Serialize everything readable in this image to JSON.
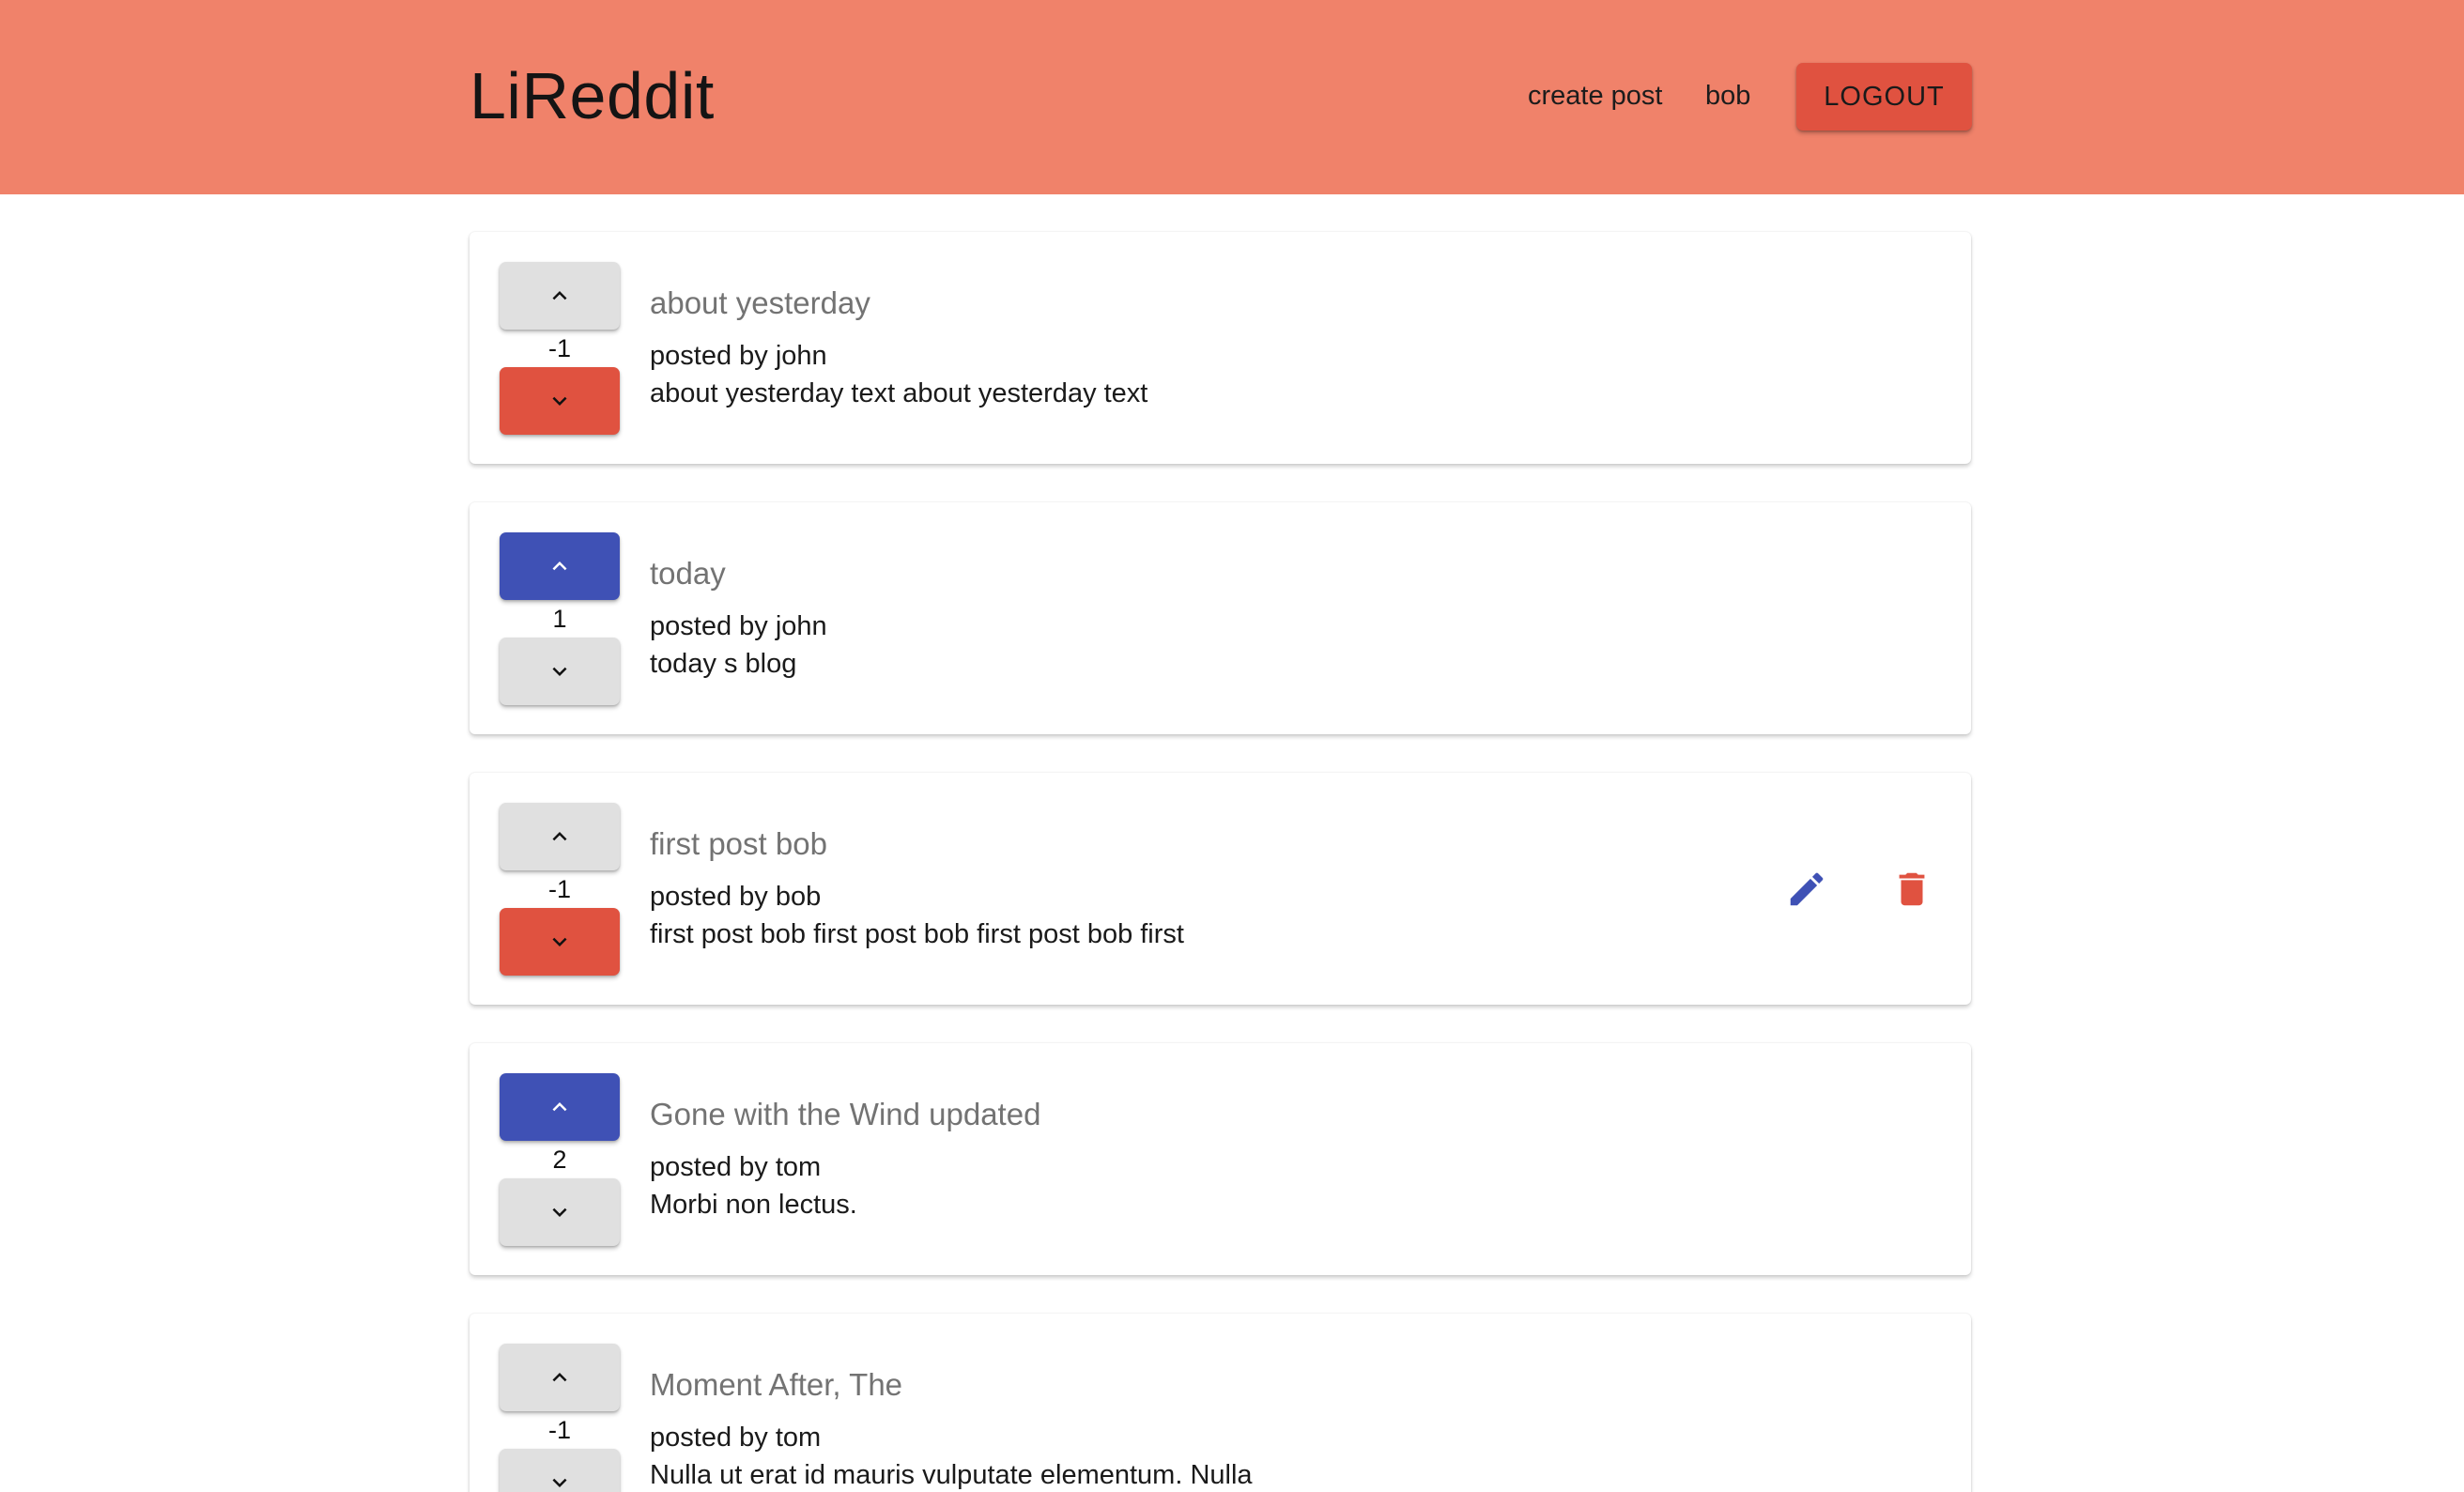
{
  "header": {
    "brand": "LiReddit",
    "create_post_label": "create post",
    "username": "bob",
    "logout_label": "LOGOUT"
  },
  "colors": {
    "header_bg": "#f0826a",
    "upvote_active": "#3f51b5",
    "downvote_active": "#e05240",
    "vote_inactive": "#e0e0e0",
    "edit_icon": "#3f51b5",
    "delete_icon": "#e05240"
  },
  "icons": {
    "upvote": "chevron-up-icon",
    "downvote": "chevron-down-icon",
    "edit": "pencil-icon",
    "delete": "trash-icon"
  },
  "posts": [
    {
      "title": "about yesterday",
      "author_line": "posted by john",
      "snippet": "about yesterday text about yesterday text",
      "points": "-1",
      "vote_status": "down",
      "editable": false
    },
    {
      "title": "today",
      "author_line": "posted by john",
      "snippet": "today s blog",
      "points": "1",
      "vote_status": "up",
      "editable": false
    },
    {
      "title": "first post bob",
      "author_line": "posted by bob",
      "snippet": "first post bob first post bob first post bob first",
      "points": "-1",
      "vote_status": "down",
      "editable": true
    },
    {
      "title": "Gone with the Wind updated",
      "author_line": "posted by tom",
      "snippet": "Morbi non lectus.",
      "points": "2",
      "vote_status": "up",
      "editable": false
    },
    {
      "title": "Moment After, The",
      "author_line": "posted by tom",
      "snippet": "Nulla ut erat id mauris vulputate elementum. Nulla",
      "points": "-1",
      "vote_status": "none",
      "editable": false
    }
  ]
}
